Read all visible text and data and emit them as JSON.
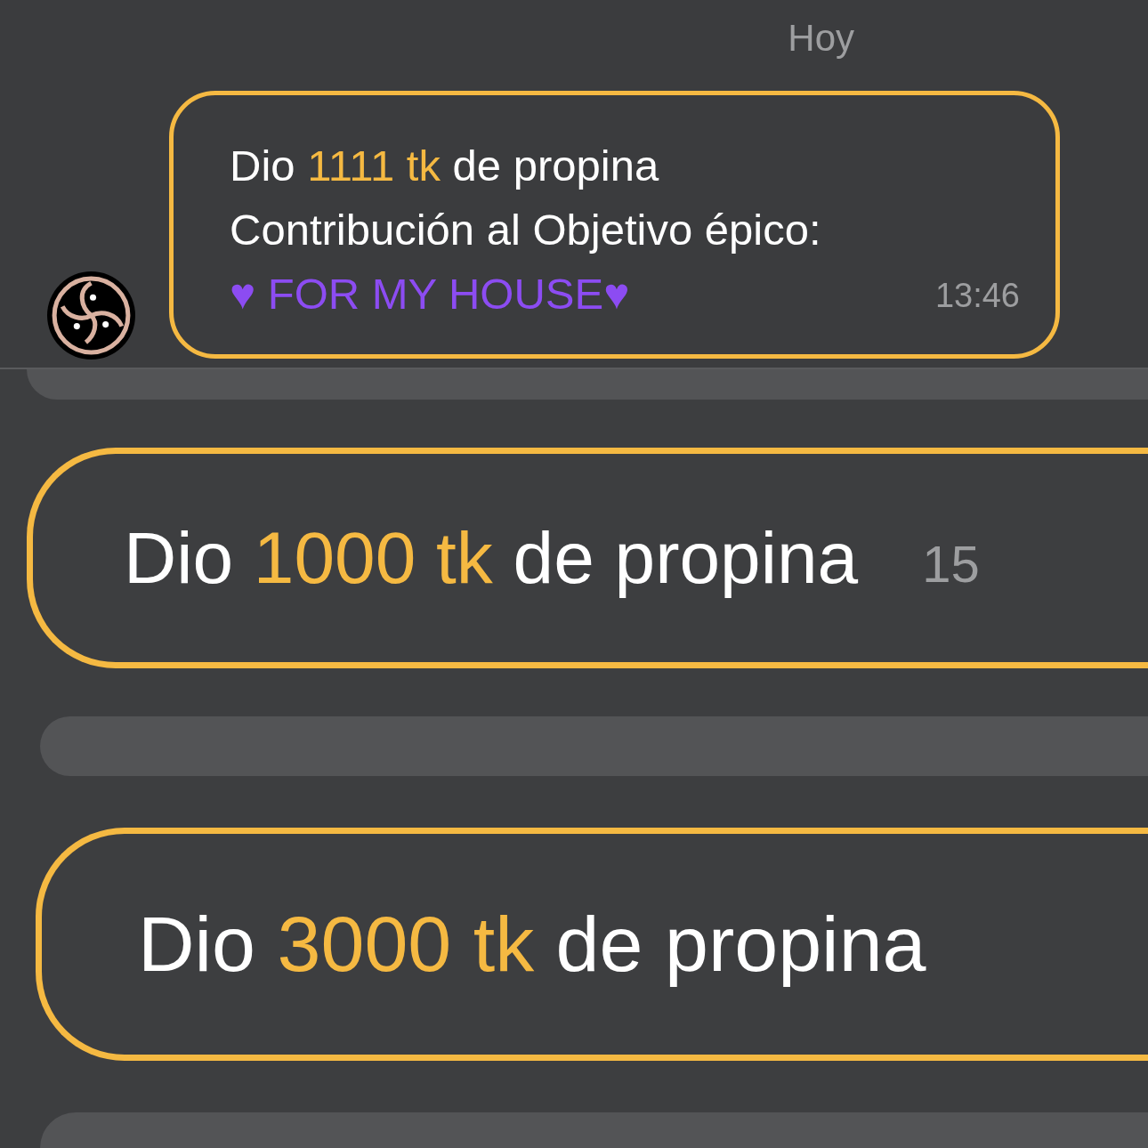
{
  "top_chat": {
    "date_label": "Hoy",
    "message": {
      "lines": [
        [
          {
            "text": "Dio ",
            "color": "#ffffff"
          },
          {
            "text": "1111 tk",
            "color": "#f5b942"
          },
          {
            "text": " de propina",
            "color": "#ffffff"
          }
        ],
        [
          {
            "text": "Contribución al Objetivo épico:",
            "color": "#ffffff"
          }
        ],
        [
          {
            "text": "♥ FOR MY HOUSE♥",
            "color": "#8c4cf2"
          }
        ]
      ],
      "time": "13:46"
    }
  },
  "lower_chat": {
    "messages": [
      {
        "kind": "plain_bubble"
      },
      {
        "kind": "tip",
        "segments": [
          {
            "text": "Dio ",
            "color": "#ffffff"
          },
          {
            "text": "1000 tk",
            "color": "#f5b942"
          },
          {
            "text": " de propina",
            "color": "#ffffff"
          }
        ],
        "time": "15"
      },
      {
        "kind": "plain_bubble"
      },
      {
        "kind": "tip",
        "segments": [
          {
            "text": "Dio ",
            "color": "#ffffff"
          },
          {
            "text": "3000 tk",
            "color": "#f5b942"
          },
          {
            "text": " de propina",
            "color": "#ffffff"
          }
        ]
      },
      {
        "kind": "plain_bubble"
      }
    ]
  }
}
